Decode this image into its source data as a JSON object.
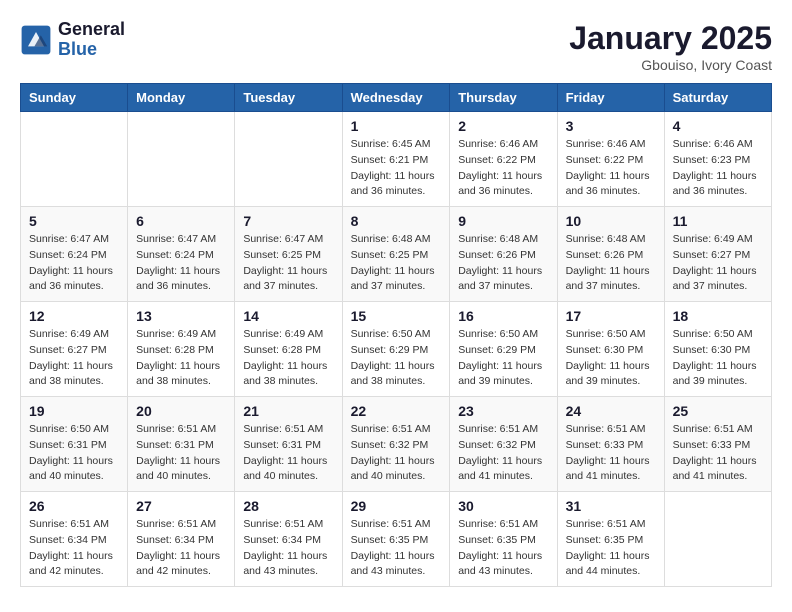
{
  "header": {
    "logo_line1": "General",
    "logo_line2": "Blue",
    "month_title": "January 2025",
    "location": "Gbouiso, Ivory Coast"
  },
  "weekdays": [
    "Sunday",
    "Monday",
    "Tuesday",
    "Wednesday",
    "Thursday",
    "Friday",
    "Saturday"
  ],
  "weeks": [
    [
      {
        "day": "",
        "info": ""
      },
      {
        "day": "",
        "info": ""
      },
      {
        "day": "",
        "info": ""
      },
      {
        "day": "1",
        "info": "Sunrise: 6:45 AM\nSunset: 6:21 PM\nDaylight: 11 hours\nand 36 minutes."
      },
      {
        "day": "2",
        "info": "Sunrise: 6:46 AM\nSunset: 6:22 PM\nDaylight: 11 hours\nand 36 minutes."
      },
      {
        "day": "3",
        "info": "Sunrise: 6:46 AM\nSunset: 6:22 PM\nDaylight: 11 hours\nand 36 minutes."
      },
      {
        "day": "4",
        "info": "Sunrise: 6:46 AM\nSunset: 6:23 PM\nDaylight: 11 hours\nand 36 minutes."
      }
    ],
    [
      {
        "day": "5",
        "info": "Sunrise: 6:47 AM\nSunset: 6:24 PM\nDaylight: 11 hours\nand 36 minutes."
      },
      {
        "day": "6",
        "info": "Sunrise: 6:47 AM\nSunset: 6:24 PM\nDaylight: 11 hours\nand 36 minutes."
      },
      {
        "day": "7",
        "info": "Sunrise: 6:47 AM\nSunset: 6:25 PM\nDaylight: 11 hours\nand 37 minutes."
      },
      {
        "day": "8",
        "info": "Sunrise: 6:48 AM\nSunset: 6:25 PM\nDaylight: 11 hours\nand 37 minutes."
      },
      {
        "day": "9",
        "info": "Sunrise: 6:48 AM\nSunset: 6:26 PM\nDaylight: 11 hours\nand 37 minutes."
      },
      {
        "day": "10",
        "info": "Sunrise: 6:48 AM\nSunset: 6:26 PM\nDaylight: 11 hours\nand 37 minutes."
      },
      {
        "day": "11",
        "info": "Sunrise: 6:49 AM\nSunset: 6:27 PM\nDaylight: 11 hours\nand 37 minutes."
      }
    ],
    [
      {
        "day": "12",
        "info": "Sunrise: 6:49 AM\nSunset: 6:27 PM\nDaylight: 11 hours\nand 38 minutes."
      },
      {
        "day": "13",
        "info": "Sunrise: 6:49 AM\nSunset: 6:28 PM\nDaylight: 11 hours\nand 38 minutes."
      },
      {
        "day": "14",
        "info": "Sunrise: 6:49 AM\nSunset: 6:28 PM\nDaylight: 11 hours\nand 38 minutes."
      },
      {
        "day": "15",
        "info": "Sunrise: 6:50 AM\nSunset: 6:29 PM\nDaylight: 11 hours\nand 38 minutes."
      },
      {
        "day": "16",
        "info": "Sunrise: 6:50 AM\nSunset: 6:29 PM\nDaylight: 11 hours\nand 39 minutes."
      },
      {
        "day": "17",
        "info": "Sunrise: 6:50 AM\nSunset: 6:30 PM\nDaylight: 11 hours\nand 39 minutes."
      },
      {
        "day": "18",
        "info": "Sunrise: 6:50 AM\nSunset: 6:30 PM\nDaylight: 11 hours\nand 39 minutes."
      }
    ],
    [
      {
        "day": "19",
        "info": "Sunrise: 6:50 AM\nSunset: 6:31 PM\nDaylight: 11 hours\nand 40 minutes."
      },
      {
        "day": "20",
        "info": "Sunrise: 6:51 AM\nSunset: 6:31 PM\nDaylight: 11 hours\nand 40 minutes."
      },
      {
        "day": "21",
        "info": "Sunrise: 6:51 AM\nSunset: 6:31 PM\nDaylight: 11 hours\nand 40 minutes."
      },
      {
        "day": "22",
        "info": "Sunrise: 6:51 AM\nSunset: 6:32 PM\nDaylight: 11 hours\nand 40 minutes."
      },
      {
        "day": "23",
        "info": "Sunrise: 6:51 AM\nSunset: 6:32 PM\nDaylight: 11 hours\nand 41 minutes."
      },
      {
        "day": "24",
        "info": "Sunrise: 6:51 AM\nSunset: 6:33 PM\nDaylight: 11 hours\nand 41 minutes."
      },
      {
        "day": "25",
        "info": "Sunrise: 6:51 AM\nSunset: 6:33 PM\nDaylight: 11 hours\nand 41 minutes."
      }
    ],
    [
      {
        "day": "26",
        "info": "Sunrise: 6:51 AM\nSunset: 6:34 PM\nDaylight: 11 hours\nand 42 minutes."
      },
      {
        "day": "27",
        "info": "Sunrise: 6:51 AM\nSunset: 6:34 PM\nDaylight: 11 hours\nand 42 minutes."
      },
      {
        "day": "28",
        "info": "Sunrise: 6:51 AM\nSunset: 6:34 PM\nDaylight: 11 hours\nand 43 minutes."
      },
      {
        "day": "29",
        "info": "Sunrise: 6:51 AM\nSunset: 6:35 PM\nDaylight: 11 hours\nand 43 minutes."
      },
      {
        "day": "30",
        "info": "Sunrise: 6:51 AM\nSunset: 6:35 PM\nDaylight: 11 hours\nand 43 minutes."
      },
      {
        "day": "31",
        "info": "Sunrise: 6:51 AM\nSunset: 6:35 PM\nDaylight: 11 hours\nand 44 minutes."
      },
      {
        "day": "",
        "info": ""
      }
    ]
  ]
}
